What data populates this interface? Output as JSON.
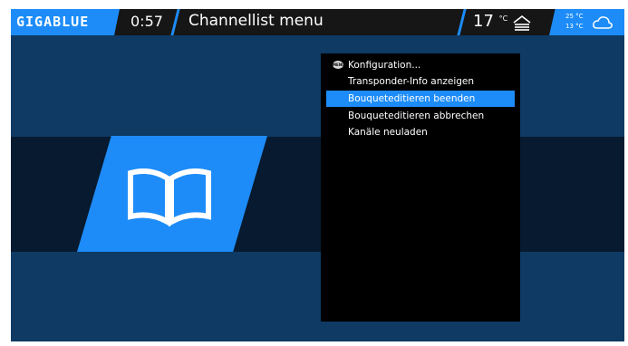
{
  "topbar": {
    "logo": "GIGABLUE",
    "clock": "0:57",
    "title": "Channellist menu",
    "temperature": "17",
    "temperature_unit": "°C",
    "home_icon": "home-icon",
    "weather": {
      "high": "25 °C",
      "low": "13 °C",
      "icon": "cloud-icon"
    }
  },
  "main": {
    "tile_icon": "book-icon"
  },
  "context_menu": {
    "items": [
      {
        "label": "Konfiguration...",
        "badge": "MENU",
        "selected": false
      },
      {
        "label": "Transponder-Info anzeigen",
        "selected": false
      },
      {
        "label": "Bouqueteditieren beenden",
        "selected": true
      },
      {
        "label": "Bouqueteditieren abbrechen",
        "selected": false
      },
      {
        "label": "Kanäle neuladen",
        "selected": false
      }
    ]
  },
  "colors": {
    "accent": "#1d8cf8",
    "background": "#0e3a64",
    "band": "#071a2f",
    "bar": "#161616"
  }
}
